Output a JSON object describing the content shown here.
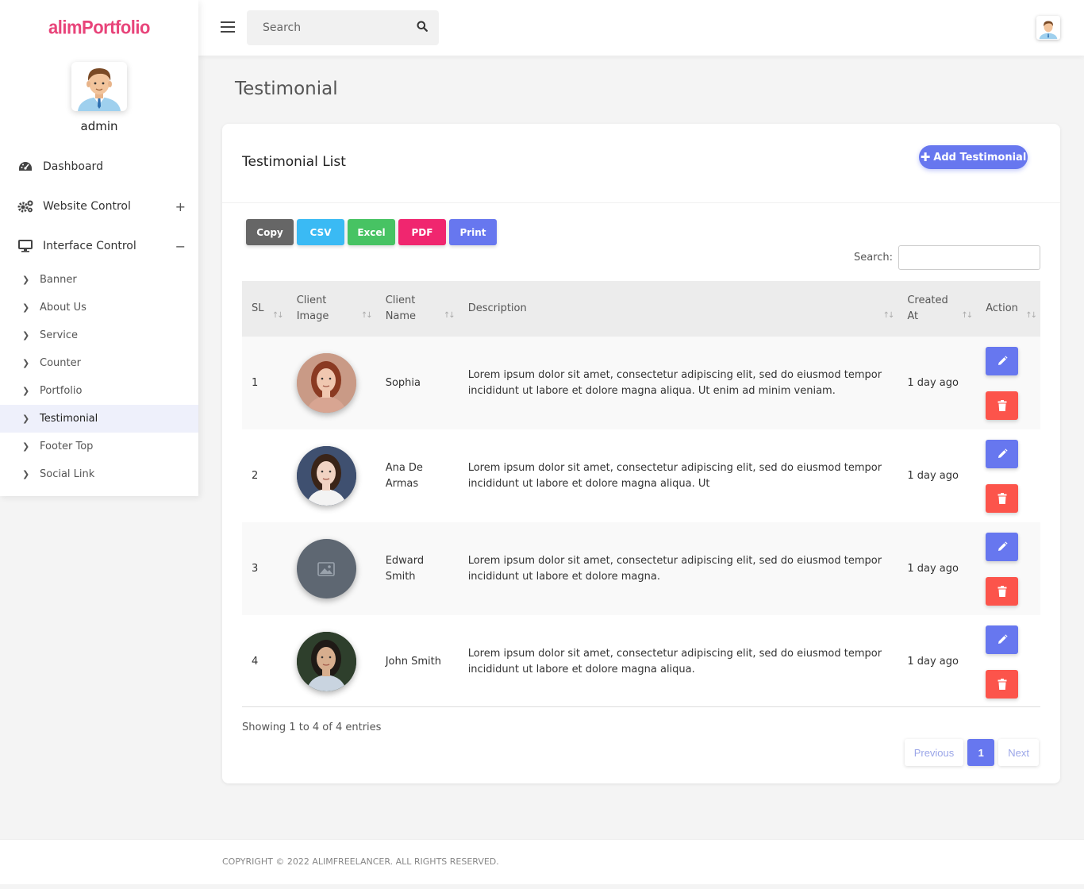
{
  "brand": "alimPortfolio",
  "user": {
    "name": "admin"
  },
  "header": {
    "search_placeholder": "Search"
  },
  "sidebar": {
    "menu": [
      {
        "label": "Dashboard",
        "icon": "gauge-icon",
        "toggle": ""
      },
      {
        "label": "Website Control",
        "icon": "gears-icon",
        "toggle": "+"
      },
      {
        "label": "Interface Control",
        "icon": "desktop-icon",
        "toggle": "−"
      }
    ],
    "submenu": [
      "Banner",
      "About Us",
      "Service",
      "Counter",
      "Portfolio",
      "Testimonial",
      "Footer Top",
      "Social Link"
    ],
    "active_submenu": "Testimonial"
  },
  "page": {
    "title": "Testimonial"
  },
  "card": {
    "title": "Testimonial List",
    "add_button": "Add Testimonial",
    "export_buttons": [
      {
        "label": "Copy",
        "color": "#6c757d"
      },
      {
        "label": "CSV",
        "color": "#3abaf4"
      },
      {
        "label": "Excel",
        "color": "#47c363"
      },
      {
        "label": "PDF",
        "color": "#f0266f"
      },
      {
        "label": "Print",
        "color": "#6777ef"
      }
    ],
    "search_label": "Search:"
  },
  "table": {
    "columns": [
      "SL",
      "Client Image",
      "Client Name",
      "Description",
      "Created At",
      "Action"
    ],
    "rows": [
      {
        "sl": "1",
        "name": "Sophia",
        "image": "photo-woman-redhair",
        "description": "Lorem ipsum dolor sit amet, consectetur adipiscing elit, sed do eiusmod tempor incididunt ut labore et dolore magna aliqua. Ut enim ad minim veniam.",
        "created": "1 day ago"
      },
      {
        "sl": "2",
        "name": "Ana De Armas",
        "image": "photo-woman-darkhair",
        "description": "Lorem ipsum dolor sit amet, consectetur adipiscing elit, sed do eiusmod tempor incididunt ut labore et dolore magna aliqua. Ut",
        "created": "1 day ago"
      },
      {
        "sl": "3",
        "name": "Edward Smith",
        "image": "image-placeholder-icon",
        "description": "Lorem ipsum dolor sit amet, consectetur adipiscing elit, sed do eiusmod tempor incididunt ut labore et dolore magna.",
        "created": "1 day ago"
      },
      {
        "sl": "4",
        "name": "John Smith",
        "image": "photo-man",
        "description": "Lorem ipsum dolor sit amet, consectetur adipiscing elit, sed do eiusmod tempor incididunt ut labore et dolore magna aliqua.",
        "created": "1 day ago"
      }
    ],
    "info": "Showing 1 to 4 of 4 entries"
  },
  "pagination": {
    "previous": "Previous",
    "current": "1",
    "next": "Next"
  },
  "footer": {
    "copyright": "COPYRIGHT © 2022 ALIMFREELANCER. ALL RIGHTS RESERVED."
  },
  "colors": {
    "primary": "#6777ef",
    "danger": "#fc544b",
    "brand": "#e8447a"
  }
}
